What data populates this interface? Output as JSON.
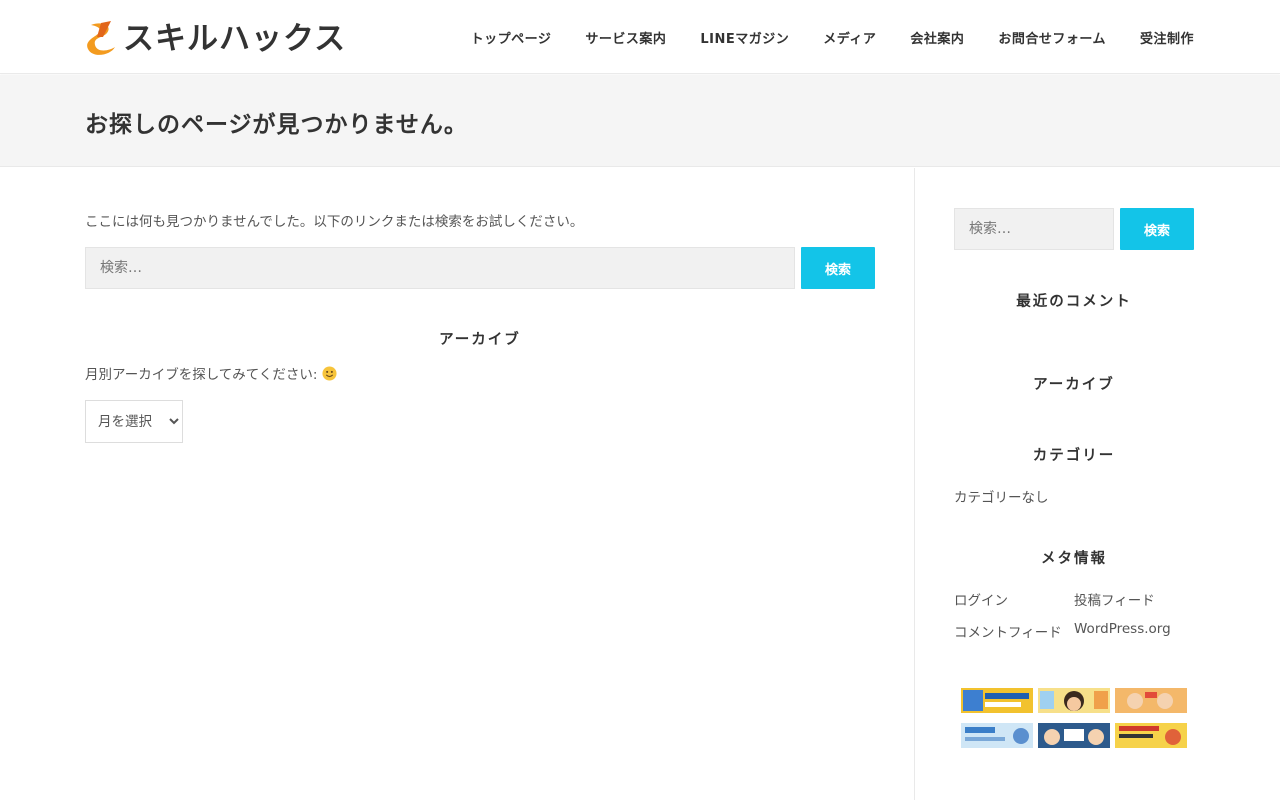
{
  "header": {
    "logo_text": "スキルハックス",
    "logo_colors": {
      "mark_orange": "#f39b1f",
      "mark_dark": "#e2661a"
    },
    "nav": [
      {
        "label": "トップページ"
      },
      {
        "label": "サービス案内"
      },
      {
        "label": "LINEマガジン"
      },
      {
        "label": "メディア"
      },
      {
        "label": "会社案内"
      },
      {
        "label": "お問合せフォーム"
      },
      {
        "label": "受注制作"
      }
    ]
  },
  "page": {
    "title": "お探しのページが見つかりません。"
  },
  "main": {
    "notfound_message": "ここには何も見つかりませんでした。以下のリンクまたは検索をお試しください。",
    "search": {
      "placeholder": "検索…",
      "button_label": "検索"
    },
    "archive": {
      "heading": "アーカイブ",
      "description": "月別アーカイブを探してみてください:",
      "description_icon": "smiley-icon",
      "select_value": "月を選択"
    }
  },
  "sidebar": {
    "search": {
      "placeholder": "検索…",
      "button_label": "検索"
    },
    "recent_comments_heading": "最近のコメント",
    "archive_heading": "アーカイブ",
    "categories_heading": "カテゴリー",
    "categories_empty": "カテゴリーなし",
    "meta_heading": "メタ情報",
    "meta_links": [
      {
        "label": "ログイン"
      },
      {
        "label": "投稿フィード"
      },
      {
        "label": "コメントフィード"
      },
      {
        "label": "WordPress.org"
      }
    ],
    "banner_count": 6
  },
  "colors": {
    "accent": "#13c4e8",
    "title_band": "#f5f5f5",
    "heading_text": "#333333",
    "body_text": "#555555"
  }
}
